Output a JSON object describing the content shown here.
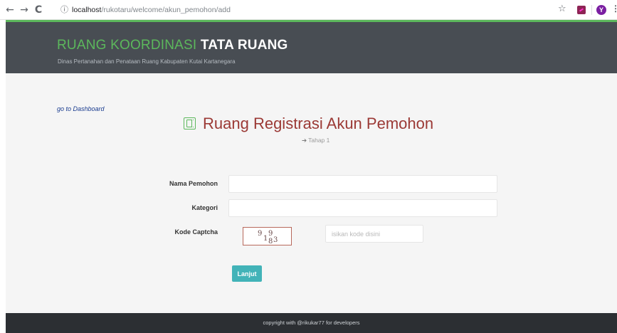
{
  "browser": {
    "back_icon": "←",
    "forward_icon": "→",
    "reload_icon": "C",
    "info_icon": "ⓘ",
    "url_host": "localhost",
    "url_path": "/rukotaru/welcome/akun_pemohon/add",
    "star_icon": "☆",
    "avatar_letter": "Y",
    "menu_icon": "⋮"
  },
  "header": {
    "brand_light": "RUANG KOORDINASI ",
    "brand_bold": "TATA RUANG",
    "subtitle": "Dinas Pertanahan dan Penataan Ruang Kabupaten Kutai Kartanegara",
    "accent_color": "#5cb85c",
    "background_color": "#484d53"
  },
  "nav": {
    "dashboard_link": "go to Dashboard"
  },
  "main": {
    "title": "Ruang Registrasi Akun Pemohon",
    "title_icon": "contact-book-icon",
    "step_arrow": "➔",
    "step_label": "Tahap 1"
  },
  "form": {
    "nama_label": "Nama Pemohon",
    "nama_value": "",
    "kategori_label": "Kategori",
    "kategori_value": "",
    "captcha_label": "Kode Captcha",
    "captcha_chars": [
      "9",
      "1",
      "9",
      "3",
      "8"
    ],
    "captcha_placeholder": "isikan kode disini",
    "submit_label": "Lanjut",
    "submit_color": "#42b3b8"
  },
  "footer": {
    "copyright": "copyright with @rikukar77 for developers"
  }
}
